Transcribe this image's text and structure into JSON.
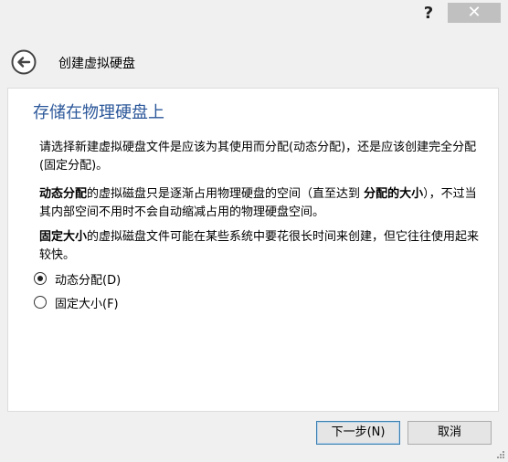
{
  "titlebar": {
    "help_label": "?",
    "close_label": "✕"
  },
  "header": {
    "title": "创建虚拟硬盘"
  },
  "page": {
    "heading": "存储在物理硬盘上",
    "intro": "请选择新建虚拟硬盘文件是应该为其使用而分配(动态分配)，还是应该创建完全分配(固定分配)。",
    "dynamic_term": "动态分配",
    "dynamic_desc_a": "的虚拟磁盘只是逐渐占用物理硬盘的空间（直至达到 ",
    "dynamic_term2": "分配的大小",
    "dynamic_desc_b": "），不过当其内部空间不用时不会自动缩减占用的物理硬盘空间。",
    "fixed_term": "固定大小",
    "fixed_desc": "的虚拟磁盘文件可能在某些系统中要花很长时间来创建，但它往往使用起来较快。"
  },
  "options": [
    {
      "label": "动态分配(D)",
      "checked": true
    },
    {
      "label": "固定大小(F)",
      "checked": false
    }
  ],
  "buttons": {
    "next": "下一步(N)",
    "cancel": "取消"
  },
  "colors": {
    "heading": "#2b579a",
    "background": "#f0f0f0",
    "content": "#ffffff"
  },
  "icons": {
    "back": "back-arrow-icon",
    "help": "help-icon",
    "close": "close-icon",
    "grip": "resize-grip-icon"
  }
}
